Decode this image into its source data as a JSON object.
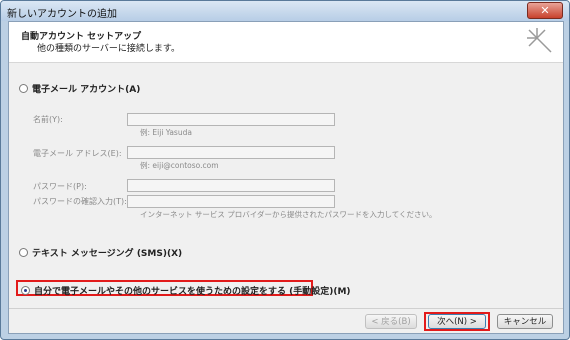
{
  "window": {
    "title": "新しいアカウントの追加",
    "close_label": "✕"
  },
  "header": {
    "title": "自動アカウント セットアップ",
    "subtitle": "他の種類のサーバーに接続します。"
  },
  "options": {
    "email_account": "電子メール アカウント(A)",
    "text_messaging": "テキスト メッセージング (SMS)(X)",
    "manual_setup": "自分で電子メールやその他のサービスを使うための設定をする (手動設定)(M)"
  },
  "fields": {
    "name_label": "名前(Y):",
    "name_hint": "例: Eiji Yasuda",
    "email_label": "電子メール アドレス(E):",
    "email_hint": "例: eiji@contoso.com",
    "password_label": "パスワード(P):",
    "password_confirm_label": "パスワードの確認入力(T):",
    "password_hint": "インターネット サービス プロバイダーから提供されたパスワードを入力してください。"
  },
  "buttons": {
    "back": "< 戻る(B)",
    "next": "次へ(N) >",
    "cancel": "キャンセル"
  }
}
